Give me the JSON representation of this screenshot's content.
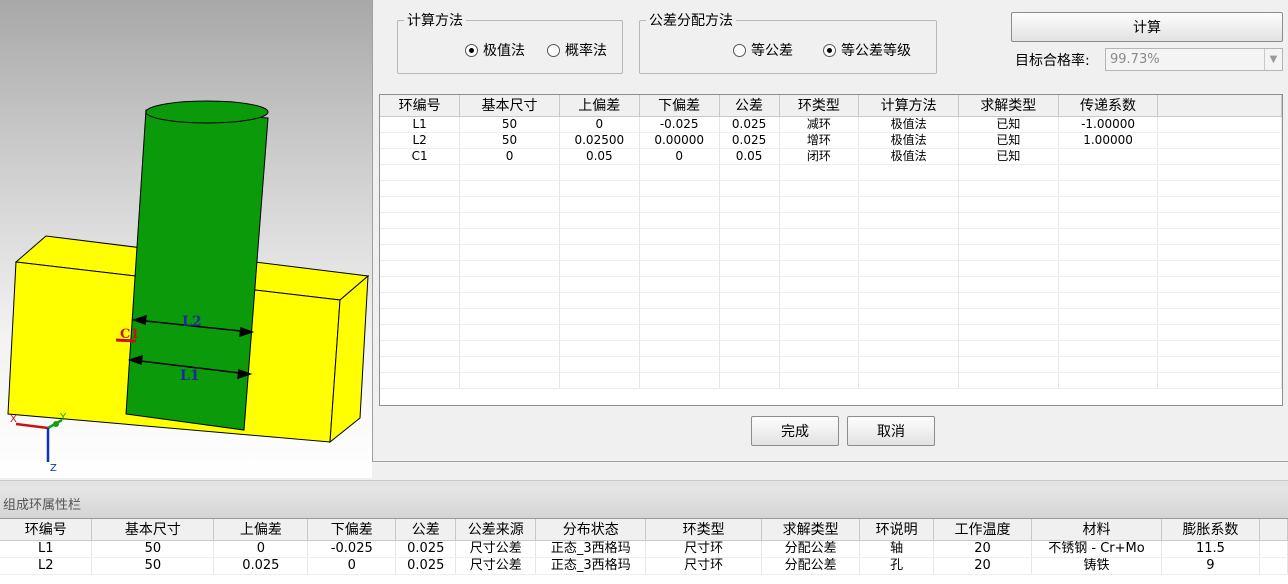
{
  "calc_method": {
    "legend": "计算方法",
    "options": [
      {
        "label": "极值法",
        "selected": true
      },
      {
        "label": "概率法",
        "selected": false
      }
    ]
  },
  "tol_alloc": {
    "legend": "公差分配方法",
    "options": [
      {
        "label": "等公差",
        "selected": false
      },
      {
        "label": "等公差等级",
        "selected": true
      }
    ]
  },
  "calc_button": "计算",
  "target_rate": {
    "label": "目标合格率:",
    "value": "99.73%"
  },
  "chain_table": {
    "headers": [
      "环编号",
      "基本尺寸",
      "上偏差",
      "下偏差",
      "公差",
      "环类型",
      "计算方法",
      "求解类型",
      "传递系数"
    ],
    "rows": [
      [
        "L1",
        "50",
        "0",
        "-0.025",
        "0.025",
        "减环",
        "极值法",
        "已知",
        "-1.00000"
      ],
      [
        "L2",
        "50",
        "0.02500",
        "0.00000",
        "0.025",
        "增环",
        "极值法",
        "已知",
        "1.00000"
      ],
      [
        "C1",
        "0",
        "0.05",
        "0",
        "0.05",
        "闭环",
        "极值法",
        "已知",
        ""
      ]
    ]
  },
  "buttons": {
    "done": "完成",
    "cancel": "取消"
  },
  "props": {
    "title": "组成环属性栏",
    "headers": [
      "环编号",
      "基本尺寸",
      "上偏差",
      "下偏差",
      "公差",
      "公差来源",
      "分布状态",
      "环类型",
      "求解类型",
      "环说明",
      "工作温度",
      "材料",
      "膨胀系数"
    ],
    "rows": [
      [
        "L1",
        "50",
        "0",
        "-0.025",
        "0.025",
        "尺寸公差",
        "正态_3西格玛",
        "尺寸环",
        "分配公差",
        "轴",
        "20",
        "不锈钢 - Cr+Mo",
        "11.5"
      ],
      [
        "L2",
        "50",
        "0.025",
        "0",
        "0.025",
        "尺寸公差",
        "正态_3西格玛",
        "尺寸环",
        "分配公差",
        "孔",
        "20",
        "铸铁",
        "9"
      ]
    ]
  },
  "viewport": {
    "dim_labels": [
      "L2",
      "L1",
      "C1"
    ],
    "axes": [
      "X",
      "Y",
      "Z"
    ],
    "colors": {
      "block": "#ffff00",
      "shaft": "#0a9a0a",
      "dim": "#1a2a9a"
    }
  }
}
